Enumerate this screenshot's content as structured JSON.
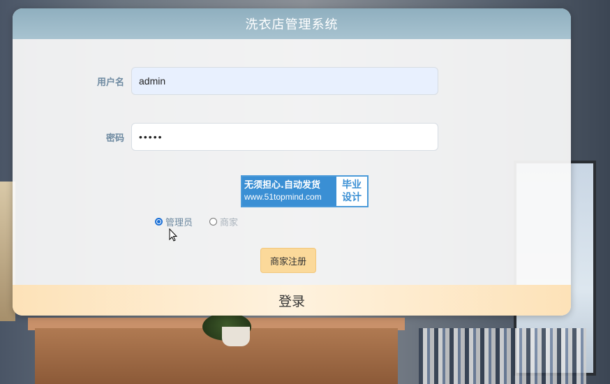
{
  "header": {
    "title": "洗衣店管理系统"
  },
  "form": {
    "username": {
      "label": "用户名",
      "value": "admin"
    },
    "password": {
      "label": "密码",
      "value": "•••••"
    }
  },
  "ad": {
    "line1": "无须担心.自动发货",
    "line2": "www.51topmind.com",
    "right_top": "毕业",
    "right_bottom": "设计"
  },
  "roles": {
    "options": [
      {
        "label": "管理员",
        "checked": true
      },
      {
        "label": "商家",
        "checked": false
      }
    ]
  },
  "buttons": {
    "register": "商家注册",
    "login": "登录"
  },
  "colors": {
    "header": "#a8c3d0",
    "register_bg": "#fbd99a",
    "login_bg": "#fde2b8",
    "label": "#6e8aa1",
    "ad_blue": "#3a8fd4"
  }
}
